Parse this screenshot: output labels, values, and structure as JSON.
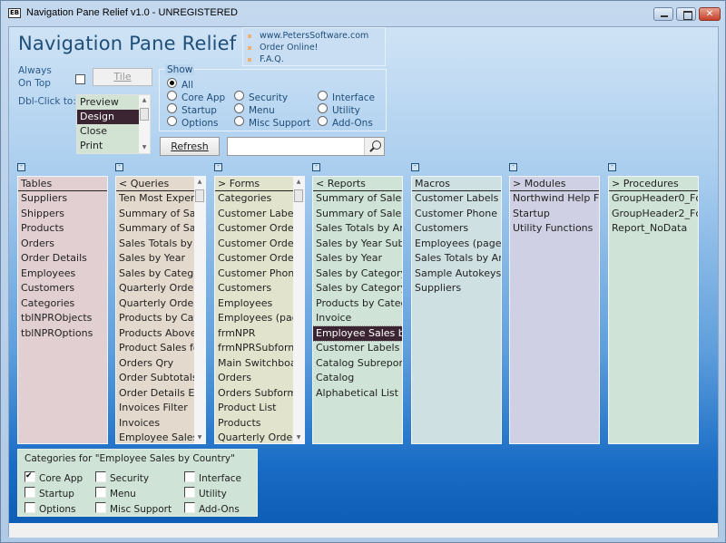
{
  "window": {
    "title": "Navigation Pane Relief v1.0 - UNREGISTERED",
    "icon_text": "EB"
  },
  "header": {
    "app_title": "Navigation Pane Relief",
    "links": [
      "www.PetersSoftware.com",
      "Order Online!",
      "F.A.Q."
    ]
  },
  "controls": {
    "always_on_top_label_1": "Always",
    "always_on_top_label_2": "On Top",
    "tile_label": "Tile",
    "dbl_click_label": "Dbl-Click to:",
    "dbl_click_options": [
      "Preview",
      "Design",
      "Close",
      "Print"
    ],
    "dbl_click_selected": "Design",
    "refresh_label": "Refresh",
    "search_value": "",
    "search_placeholder": ""
  },
  "show": {
    "title": "Show",
    "options": [
      "All",
      "Core App",
      "Security",
      "Interface",
      "Startup",
      "Menu",
      "Utility",
      "Options",
      "Misc Support",
      "Add-Ons"
    ],
    "selected": "All"
  },
  "columns": [
    {
      "header": "Tables",
      "color": "#e2cfd2",
      "items": [
        "Suppliers",
        "Shippers",
        "Products",
        "Orders",
        "Order Details",
        "Employees",
        "Customers",
        "Categories",
        "tblNPRObjects",
        "tblNPROptions"
      ]
    },
    {
      "header": "< Queries",
      "color": "#e3d9cc",
      "items": [
        "Ten Most Exper",
        "Summary of Sal",
        "Summary of Sal",
        "Sales Totals by",
        "Sales by Year",
        "Sales by Catego",
        "Quarterly Orde",
        "Quarterly Orde",
        "Products by Cat",
        "Products Above",
        "Product Sales fo",
        "Orders Qry",
        "Order Subtotals",
        "Order Details E",
        "Invoices Filter",
        "Invoices",
        "Employee Sales"
      ]
    },
    {
      "header": "> Forms",
      "color": "#e2e3cd",
      "items": [
        "Categories",
        "Customer Label",
        "Customer Orde",
        "Customer Orde",
        "Customer Orde",
        "Customer Phon",
        "Customers",
        "Employees",
        "Employees (pag",
        "frmNPR",
        "frmNPRSubforn",
        "Main Switchboa",
        "Orders",
        "Orders Subform",
        "Product List",
        "Products",
        "Quarterly Orde"
      ]
    },
    {
      "header": "< Reports",
      "color": "#cfe4d6",
      "items": [
        "Summary of Sales",
        "Summary of Sales",
        "Sales Totals by Am",
        "Sales by Year Subr",
        "Sales by Year",
        "Sales by Category",
        "Sales by Category",
        "Products by Categ",
        "Invoice",
        "Employee Sales by",
        "Customer Labels",
        "Catalog Subreport",
        "Catalog",
        "Alphabetical List c"
      ],
      "selected_index": 9
    },
    {
      "header": "Macros",
      "color": "#cfe0e3",
      "items": [
        "Customer Labels D",
        "Customer Phone L",
        "Customers",
        "Employees (page",
        "Sales Totals by Am",
        "Sample Autokeys",
        "Suppliers"
      ]
    },
    {
      "header": "> Modules",
      "color": "#cfd0e3",
      "items": [
        "Northwind Help F",
        "Startup",
        "Utility Functions"
      ]
    },
    {
      "header": "> Procedures",
      "color": "#cfe4d6",
      "items": [
        "GroupHeader0_Fc",
        "GroupHeader2_Fc",
        "Report_NoData"
      ]
    }
  ],
  "categories": {
    "title": "Categories for \"Employee Sales by Country\"",
    "options": [
      {
        "label": "Core App",
        "checked": true
      },
      {
        "label": "Security",
        "checked": false
      },
      {
        "label": "Interface",
        "checked": false
      },
      {
        "label": "Startup",
        "checked": false
      },
      {
        "label": "Menu",
        "checked": false
      },
      {
        "label": "Utility",
        "checked": false
      },
      {
        "label": "Options",
        "checked": false
      },
      {
        "label": "Misc Support",
        "checked": false
      },
      {
        "label": "Add-Ons",
        "checked": false
      }
    ]
  }
}
